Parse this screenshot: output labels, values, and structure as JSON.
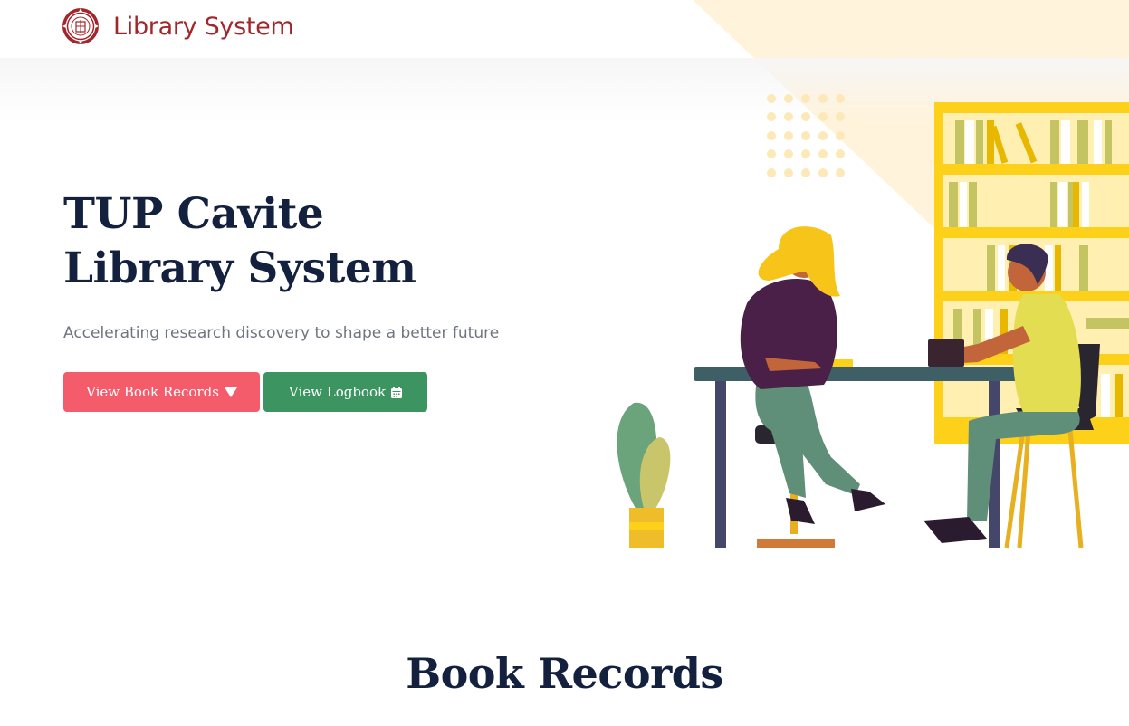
{
  "navbar": {
    "brand_text": "Library System",
    "logo_icon": "university-seal-icon"
  },
  "hero": {
    "title_line1": "TUP Cavite",
    "title_line2": "Library System",
    "subtitle": "Accelerating research discovery to shape a better future",
    "buttons": {
      "records_label": "View Book Records",
      "records_icon": "caret-down-icon",
      "logbook_label": "View Logbook",
      "logbook_icon": "calendar-icon"
    },
    "illustration_icon": "library-reading-illustration"
  },
  "section": {
    "title": "Book Records"
  },
  "colors": {
    "brand": "#a3262c",
    "heading": "#13213f",
    "records_button": "#f45c6c",
    "logbook_button": "#3c9460",
    "accent_yellow": "#fdd019",
    "background_triangle": "#fff3db"
  }
}
